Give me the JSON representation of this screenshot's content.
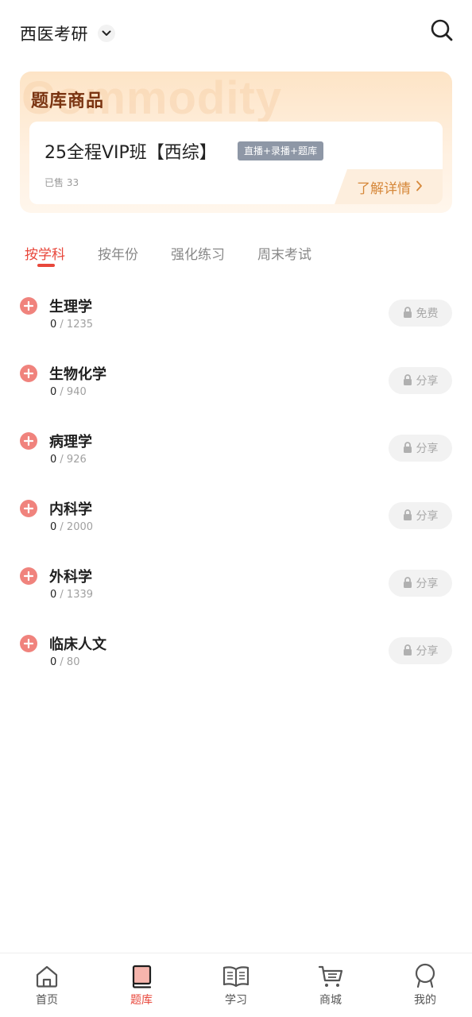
{
  "header": {
    "exam_title": "西医考研"
  },
  "commodity": {
    "watermark": "Commodity",
    "title": "题库商品",
    "product": {
      "name": "25全程VIP班【西综】",
      "tag": "直播+录播+题库",
      "sold": "已售 33",
      "detail_label": "了解详情"
    }
  },
  "tabs": [
    {
      "label": "按学科",
      "active": true
    },
    {
      "label": "按年份",
      "active": false
    },
    {
      "label": "强化练习",
      "active": false
    },
    {
      "label": "周末考试",
      "active": false
    }
  ],
  "subjects": [
    {
      "name": "生理学",
      "done": "0",
      "total": "/ 1235",
      "lock_label": "免费"
    },
    {
      "name": "生物化学",
      "done": "0",
      "total": "/ 940",
      "lock_label": "分享"
    },
    {
      "name": "病理学",
      "done": "0",
      "total": "/ 926",
      "lock_label": "分享"
    },
    {
      "name": "内科学",
      "done": "0",
      "total": "/ 2000",
      "lock_label": "分享"
    },
    {
      "name": "外科学",
      "done": "0",
      "total": "/ 1339",
      "lock_label": "分享"
    },
    {
      "name": "临床人文",
      "done": "0",
      "total": "/ 80",
      "lock_label": "分享"
    }
  ],
  "bottom_nav": [
    {
      "label": "首页",
      "icon": "home-icon",
      "active": false
    },
    {
      "label": "题库",
      "icon": "question-bank-icon",
      "active": true
    },
    {
      "label": "学习",
      "icon": "book-open-icon",
      "active": false
    },
    {
      "label": "商城",
      "icon": "cart-icon",
      "active": false
    },
    {
      "label": "我的",
      "icon": "profile-icon",
      "active": false
    }
  ],
  "colors": {
    "accent": "#e8473b",
    "commodity_title": "#7a3411",
    "detail": "#d6883a",
    "tag_bg": "#8e97a6"
  }
}
